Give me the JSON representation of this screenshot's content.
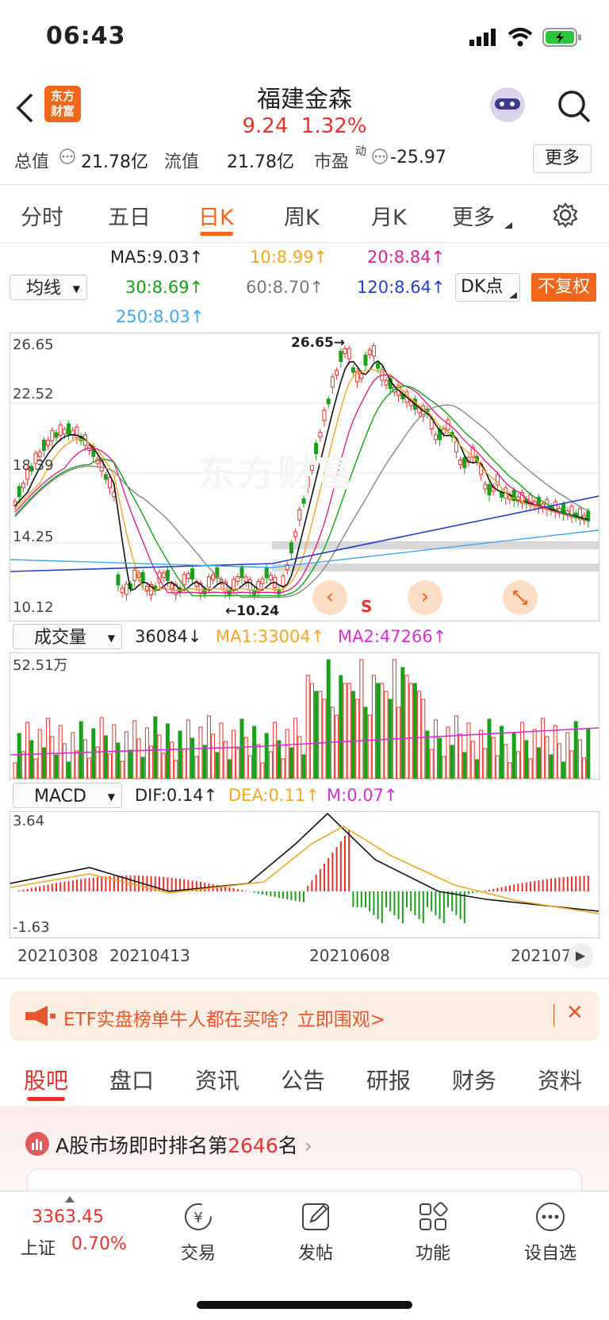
{
  "status": {
    "time": "06:43"
  },
  "header": {
    "title": "福建金森",
    "price": "9.24",
    "change": "1.32%",
    "logo_line1": "东方",
    "logo_line2": "财富"
  },
  "summary": {
    "total_cap_label": "总值",
    "total_cap": "21.78亿",
    "float_cap_label": "流值",
    "float_cap": "21.78亿",
    "pe_label": "市盈",
    "pe_sup": "动",
    "pe_value": "-25.97",
    "more": "更多"
  },
  "tabs": [
    "分时",
    "五日",
    "日K",
    "周K",
    "月K",
    "更多"
  ],
  "indicators": {
    "ma_select": "均线",
    "ma5": "MA5:9.03↑",
    "ma10": "10:8.99↑",
    "ma20": "20:8.84↑",
    "ma30": "30:8.69↑",
    "ma60": "60:8.70↑",
    "ma120": "120:8.64↑",
    "ma250": "250:8.03↑",
    "dk": "DK点",
    "fq": "不复权"
  },
  "kline": {
    "ytick1": "26.65",
    "ytick2": "22.52",
    "ytick3": "18.39",
    "ytick4": "14.25",
    "ytick5": "10.12",
    "high_label": "26.65",
    "low_label": "10.24",
    "s_label": "S",
    "watermark": "东方财富"
  },
  "volume": {
    "select": "成交量",
    "value": "36084↓",
    "ma1": "MA1:33004↑",
    "ma2": "MA2:47266↑",
    "max": "52.51万"
  },
  "macd": {
    "select": "MACD",
    "dif": "DIF:0.14↑",
    "dea": "DEA:0.11↑",
    "m": "M:0.07↑",
    "ymax": "3.64",
    "ymin": "-1.63"
  },
  "dates": [
    "20210308",
    "20210413",
    "20210608",
    "202107"
  ],
  "banner": {
    "text": "ETF实盘榜单牛人都在买啥？立即围观>"
  },
  "bottom_tabs": [
    "股吧",
    "盘口",
    "资讯",
    "公告",
    "研报",
    "财务",
    "资料"
  ],
  "rank": {
    "prefix": "A股市场即时排名第",
    "value": "2646",
    "suffix": "名"
  },
  "bottom_bar": {
    "index_value": "3363.45",
    "index_name": "上证",
    "index_change": "0.70%",
    "trade": "交易",
    "post": "发帖",
    "function": "功能",
    "watchlist": "设自选"
  },
  "colors": {
    "up": "#e8312d",
    "down": "#1aa11a",
    "accent": "#f0671b"
  }
}
